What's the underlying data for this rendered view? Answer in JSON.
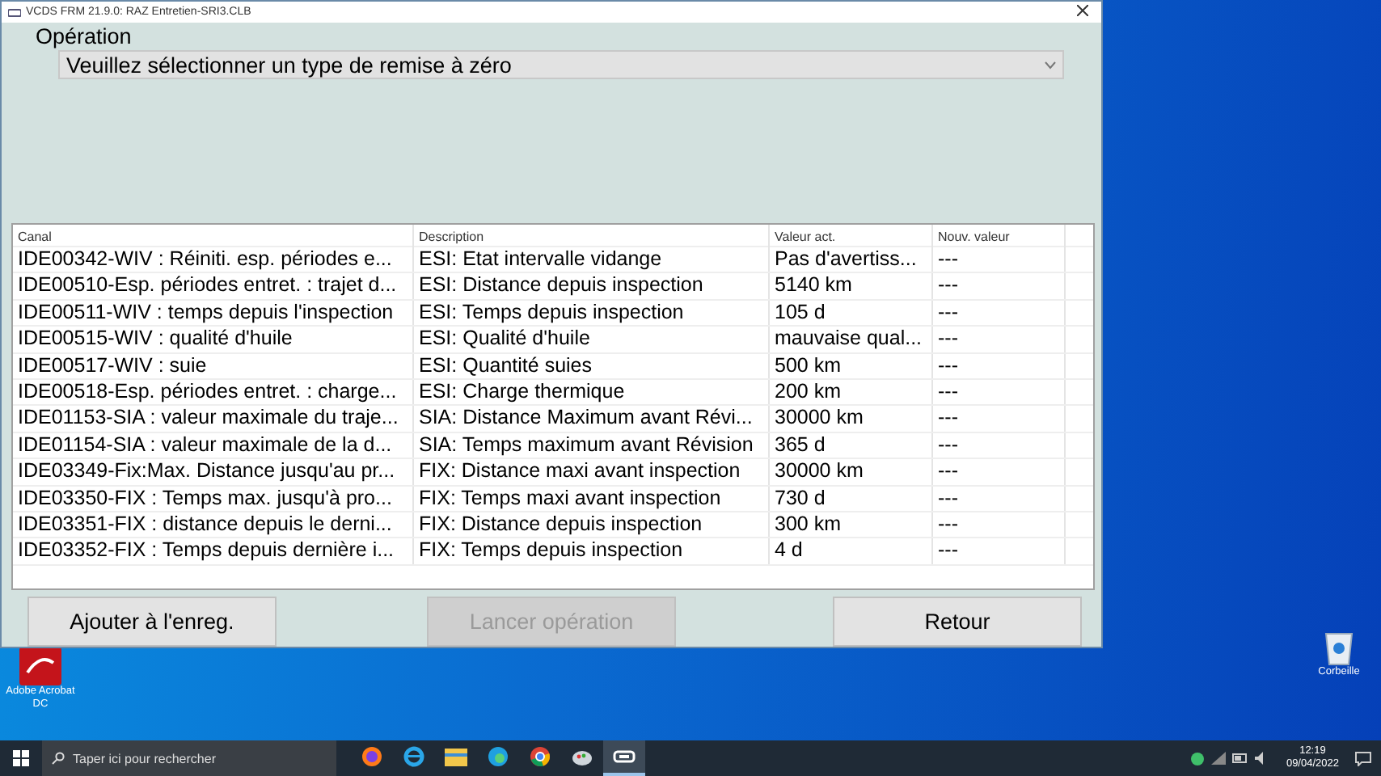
{
  "window": {
    "title": "VCDS FRM 21.9.0:  RAZ Entretien-SRI3.CLB"
  },
  "operation": {
    "label": "Opération",
    "select_value": "Veuillez sélectionner un type de remise à zéro"
  },
  "table": {
    "columns": [
      "Canal",
      "Description",
      "Valeur act.",
      "Nouv. valeur"
    ],
    "rows": [
      [
        "IDE00342-WIV : Réiniti. esp. périodes e...",
        "ESI: Etat intervalle vidange",
        "Pas d'avertiss...",
        "---"
      ],
      [
        "IDE00510-Esp. périodes entret. : trajet d...",
        "ESI: Distance depuis inspection",
        "5140 km",
        "---"
      ],
      [
        "IDE00511-WIV : temps depuis l'inspection",
        "ESI: Temps depuis inspection",
        "105 d",
        "---"
      ],
      [
        "IDE00515-WIV : qualité d'huile",
        "ESI: Qualité d'huile",
        "mauvaise qual...",
        "---"
      ],
      [
        "IDE00517-WIV : suie",
        "ESI: Quantité suies",
        "500 km",
        "---"
      ],
      [
        "IDE00518-Esp. périodes entret. : charge...",
        "ESI: Charge thermique",
        "200 km",
        "---"
      ],
      [
        "IDE01153-SIA : valeur maximale du traje...",
        "SIA: Distance Maximum avant Révi...",
        "30000 km",
        "---"
      ],
      [
        "IDE01154-SIA : valeur maximale de la d...",
        "SIA: Temps maximum avant Révision",
        "365 d",
        "---"
      ],
      [
        "IDE03349-Fix:Max. Distance jusqu'au pr...",
        "FIX: Distance maxi avant inspection",
        "30000 km",
        "---"
      ],
      [
        "IDE03350-FIX : Temps max. jusqu'à pro...",
        "FIX: Temps maxi avant inspection",
        "730 d",
        "---"
      ],
      [
        "IDE03351-FIX : distance depuis le derni...",
        "FIX: Distance depuis inspection",
        "300 km",
        "---"
      ],
      [
        "IDE03352-FIX : Temps depuis dernière i...",
        "FIX: Temps depuis inspection",
        "4 d",
        "---"
      ]
    ]
  },
  "buttons": [
    {
      "label": "Ajouter à l'enreg.",
      "disabled": false
    },
    {
      "label": "Lancer opération",
      "disabled": true
    },
    {
      "label": "Retour",
      "disabled": false
    }
  ],
  "desktop_icons": [
    {
      "kind": "pdf",
      "label": "Adobe Acrobat DC"
    },
    {
      "kind": "bin",
      "label": "Corbeille"
    }
  ],
  "taskbar": {
    "search_placeholder": "Taper ici pour rechercher",
    "apps": [
      {
        "kind": "firefox",
        "selected": false
      },
      {
        "kind": "ie",
        "selected": false
      },
      {
        "kind": "folder",
        "selected": false
      },
      {
        "kind": "edge",
        "selected": false
      },
      {
        "kind": "chrome",
        "selected": false
      },
      {
        "kind": "paint",
        "selected": false
      },
      {
        "kind": "vcds",
        "selected": true
      }
    ],
    "time": "12:19",
    "date": "09/04/2022"
  }
}
